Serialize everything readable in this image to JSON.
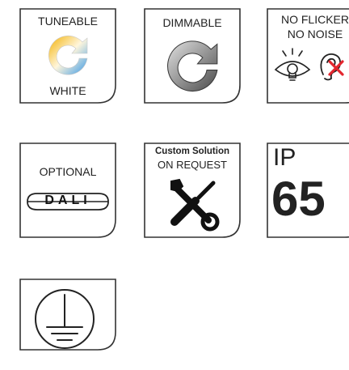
{
  "tiles": {
    "tuneable_white": {
      "top_label": "TUNEABLE",
      "bottom_label": "WHITE"
    },
    "dimmable": {
      "top_label": "DIMMABLE"
    },
    "no_flicker": {
      "line1": "NO FLICKER",
      "line2": "NO NOISE"
    },
    "optional_dali": {
      "top_label": "OPTIONAL",
      "badge_text": "DALI"
    },
    "custom_solution": {
      "line1": "Custom Solution",
      "line2": "ON REQUEST"
    },
    "ip_rating": {
      "prefix": "IP",
      "value": "65"
    },
    "earth": {}
  },
  "icons": [
    "tuneable-rotation-icon",
    "dimmable-rotation-icon",
    "eye-icon",
    "ear-crossed-icon",
    "dali-badge-icon",
    "tools-icon",
    "protective-earth-icon"
  ],
  "colors": {
    "frame": "#333333",
    "warm": "#f3b000",
    "cool": "#3a98e6",
    "grey_dark": "#555555",
    "grey_light": "#d6d6d6",
    "cross": "#e3262e"
  }
}
